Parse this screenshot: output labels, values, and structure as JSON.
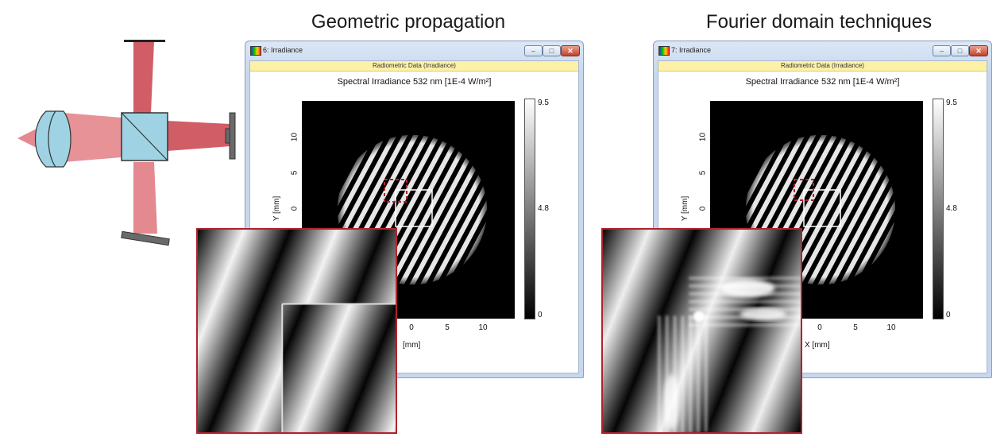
{
  "headings": {
    "geometric": "Geometric propagation",
    "fourier": "Fourier domain techniques"
  },
  "windows": [
    {
      "title": "6: Irradiance",
      "toolbar": "Radiometric Data (Irradiance)",
      "plot_title": "Spectral Irradiance 532 nm  [1E-4 W/m²]",
      "colorbar": {
        "max": "9.5",
        "mid": "4.8",
        "min": "0"
      },
      "y_ticks": [
        "10",
        "5",
        "0"
      ],
      "x_ticks": [
        "0",
        "5",
        "10"
      ],
      "y_label": "Y [mm]",
      "x_label": "[mm]"
    },
    {
      "title": "7: Irradiance",
      "toolbar": "Radiometric Data (Irradiance)",
      "plot_title": "Spectral Irradiance 532 nm  [1E-4 W/m²]",
      "colorbar": {
        "max": "9.5",
        "mid": "4.8",
        "min": "0"
      },
      "y_ticks": [
        "10",
        "5",
        "0"
      ],
      "x_ticks": [
        "0",
        "5",
        "10"
      ],
      "y_label": "Y [mm]",
      "x_label": "X [mm]"
    }
  ],
  "colors": {
    "beam": "#d9575f",
    "glass": "#9fd3e4",
    "mirror": "#5a5a5a",
    "highlight": "#b2222e",
    "window_border": "#8a9fb8",
    "toolbar": "#fdf1a8"
  },
  "icons": [
    "app-icon",
    "minimize-icon",
    "maximize-icon",
    "close-icon"
  ]
}
